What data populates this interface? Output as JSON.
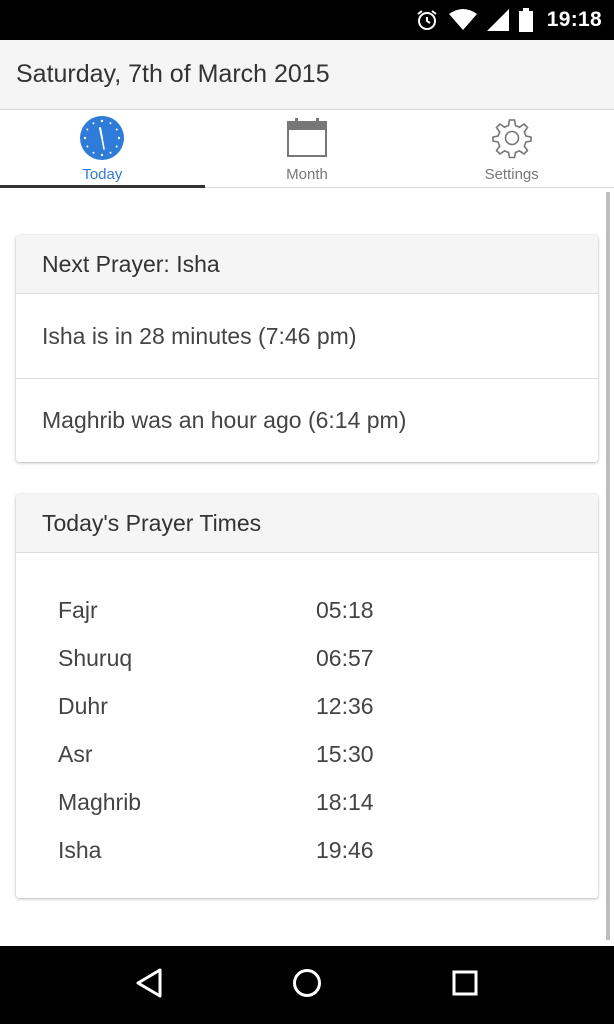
{
  "status_bar": {
    "time": "19:18",
    "icons": [
      "alarm-icon",
      "wifi-icon",
      "cell-signal-icon",
      "battery-icon"
    ]
  },
  "header": {
    "title": "Saturday, 7th of March 2015"
  },
  "tabs": [
    {
      "label": "Today",
      "icon": "clock-icon",
      "active": true
    },
    {
      "label": "Month",
      "icon": "calendar-icon",
      "active": false
    },
    {
      "label": "Settings",
      "icon": "gear-icon",
      "active": false
    }
  ],
  "next_prayer": {
    "title": "Next Prayer: Isha",
    "rows": [
      "Isha is in 28 minutes (7:46 pm)",
      "Maghrib was an hour ago (6:14 pm)"
    ]
  },
  "todays_times": {
    "title": "Today's Prayer Times",
    "prayers": [
      {
        "name": "Fajr",
        "time": "05:18"
      },
      {
        "name": "Shuruq",
        "time": "06:57"
      },
      {
        "name": "Duhr",
        "time": "12:36"
      },
      {
        "name": "Asr",
        "time": "15:30"
      },
      {
        "name": "Maghrib",
        "time": "18:14"
      },
      {
        "name": "Isha",
        "time": "19:46"
      }
    ]
  },
  "nav_bar": {
    "buttons": [
      "back-icon",
      "home-icon",
      "recents-icon"
    ]
  },
  "colors": {
    "accent": "#2f7cd8",
    "header_bg": "#f5f5f5",
    "status_bar_bg": "#000000"
  }
}
